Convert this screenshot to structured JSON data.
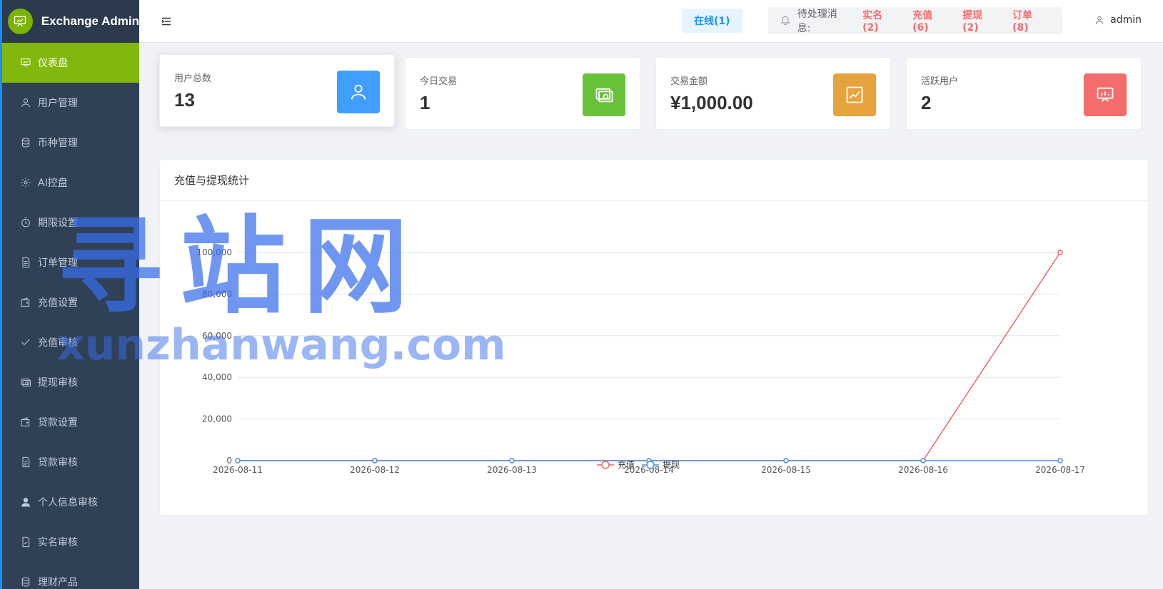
{
  "brand": {
    "title": "Exchange Admin",
    "logo_icon": "presentation-icon",
    "logo_color": "#7cb305"
  },
  "sidebar": {
    "items": [
      {
        "label": "仪表盘",
        "icon": "dashboard-icon",
        "active": true
      },
      {
        "label": "用户管理",
        "icon": "user-icon"
      },
      {
        "label": "币种管理",
        "icon": "coins-icon"
      },
      {
        "label": "AI控盘",
        "icon": "gear-icon"
      },
      {
        "label": "期限设置",
        "icon": "timer-icon"
      },
      {
        "label": "订单管理",
        "icon": "document-icon"
      },
      {
        "label": "充值设置",
        "icon": "wallet-icon"
      },
      {
        "label": "充值审核",
        "icon": "check-icon"
      },
      {
        "label": "提现审核",
        "icon": "money-icon"
      },
      {
        "label": "贷款设置",
        "icon": "wallet-icon"
      },
      {
        "label": "贷款审核",
        "icon": "document-icon"
      },
      {
        "label": "个人信息审核",
        "icon": "person-filled-icon"
      },
      {
        "label": "实名审核",
        "icon": "document-check-icon"
      },
      {
        "label": "理财产品",
        "icon": "coins-icon"
      }
    ],
    "active_color": "#82b80b",
    "bg_color": "#304156"
  },
  "header": {
    "online": "在线(1)",
    "pending_label": "待处理消息:",
    "pending_links": [
      "实名(2)",
      "充值(6)",
      "提现(2)",
      "订单(8)"
    ],
    "user": "admin"
  },
  "stats": [
    {
      "label": "用户总数",
      "value": "13",
      "icon": "user-icon",
      "color": "#409eff"
    },
    {
      "label": "今日交易",
      "value": "1",
      "icon": "money-icon",
      "color": "#67c23a"
    },
    {
      "label": "交易金额",
      "value": "¥1,000.00",
      "icon": "trend-icon",
      "color": "#e6a23c"
    },
    {
      "label": "活跃用户",
      "value": "2",
      "icon": "presentation-icon",
      "color": "#f56c6c"
    }
  ],
  "chart": {
    "title": "充值与提现统计"
  },
  "chart_data": {
    "type": "line",
    "x": [
      "2026-08-11",
      "2026-08-12",
      "2026-08-13",
      "2026-08-14",
      "2026-08-15",
      "2026-08-16",
      "2026-08-17"
    ],
    "series": [
      {
        "name": "充值",
        "values": [
          0,
          0,
          0,
          0,
          0,
          0,
          100000
        ],
        "color": "#ee6666"
      },
      {
        "name": "提现",
        "values": [
          0,
          0,
          0,
          0,
          0,
          0,
          0
        ],
        "color": "#4a90e2"
      }
    ],
    "y_ticks": [
      "0",
      "20,000",
      "40,000",
      "60,000",
      "80,000",
      "100,000"
    ],
    "ylim": [
      0,
      100000
    ],
    "grid": true,
    "legend_position": "bottom-center"
  },
  "watermark": {
    "cn": "寻站网",
    "en": "xunzhanwang.com"
  }
}
